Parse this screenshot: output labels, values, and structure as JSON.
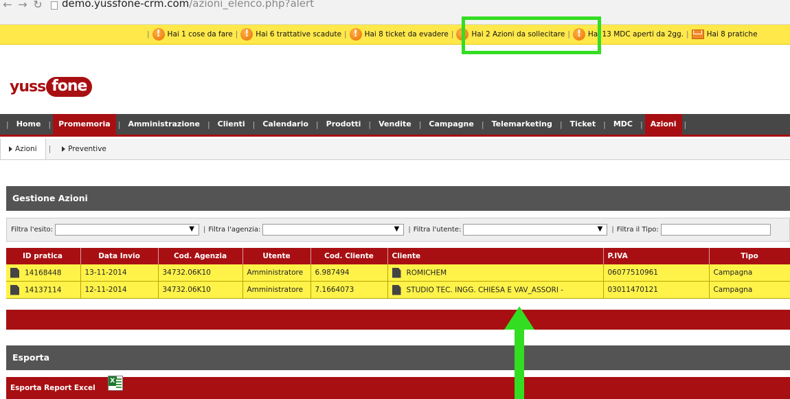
{
  "browser": {
    "url_host": "demo.yussfone-crm.com",
    "url_path": "/azioni_elenco.php?alert"
  },
  "alerts": [
    {
      "icon": "exclamation-icon",
      "text": "Hai 1 cose da fare"
    },
    {
      "icon": "exclamation-icon",
      "text": "Hai 6 trattative scadute"
    },
    {
      "icon": "exclamation-icon",
      "text": "Hai 8 ticket da evadere"
    },
    {
      "icon": "exclamation-icon",
      "text": "Hai 2 Azioni da sollecitare"
    },
    {
      "icon": "exclamation-icon",
      "text": "Hai 13 MDC aperti da 2gg."
    },
    {
      "icon": "mail-icon",
      "text": "Hai 8 pratiche"
    }
  ],
  "logo": {
    "part1": "yuss",
    "part2": "fone"
  },
  "main_menu": {
    "items": [
      "Home",
      "Promemoria",
      "Amministrazione",
      "Clienti",
      "Calendario",
      "Prodotti",
      "Vendite",
      "Campagne",
      "Telemarketing",
      "Ticket",
      "MDC",
      "Azioni"
    ],
    "active": [
      "Promemoria",
      "Azioni"
    ]
  },
  "sub_menu": {
    "items": [
      "Azioni",
      "Preventive"
    ],
    "active": "Azioni"
  },
  "gestione": {
    "title": "Gestione Azioni"
  },
  "filters": [
    {
      "label": "Filtra l'esito:",
      "value": ""
    },
    {
      "label": "Filtra l'agenzia:",
      "value": ""
    },
    {
      "label": "Filtra l'utente:",
      "value": ""
    },
    {
      "label": "Filtra il Tipo:",
      "value": ""
    }
  ],
  "table": {
    "headers": [
      "ID pratica",
      "Data Invio",
      "Cod. Agenzia",
      "Utente",
      "Cod. Cliente",
      "Cliente",
      "P.IVA",
      "Tipo"
    ],
    "rows": [
      [
        "14168448",
        "13-11-2014",
        "34732.06K10",
        "Amministratore",
        "6.987494",
        "ROMICHEM",
        "06077510961",
        "Campagna"
      ],
      [
        "14137114",
        "12-11-2014",
        "34732.06K10",
        "Amministratore",
        "7.1664073",
        "STUDIO TEC. INGG. CHIESA E VAV_ASSORI -",
        "03011470121",
        "Campagna"
      ]
    ]
  },
  "esporta": {
    "title": "Esporta",
    "report_label": "Esporta Report Excel"
  },
  "colors": {
    "brand_red": "#a80f12",
    "alert_yellow": "#ffe84a",
    "row_yellow": "#fff34a",
    "header_grey": "#545454",
    "highlight_green": "#33dd22"
  }
}
